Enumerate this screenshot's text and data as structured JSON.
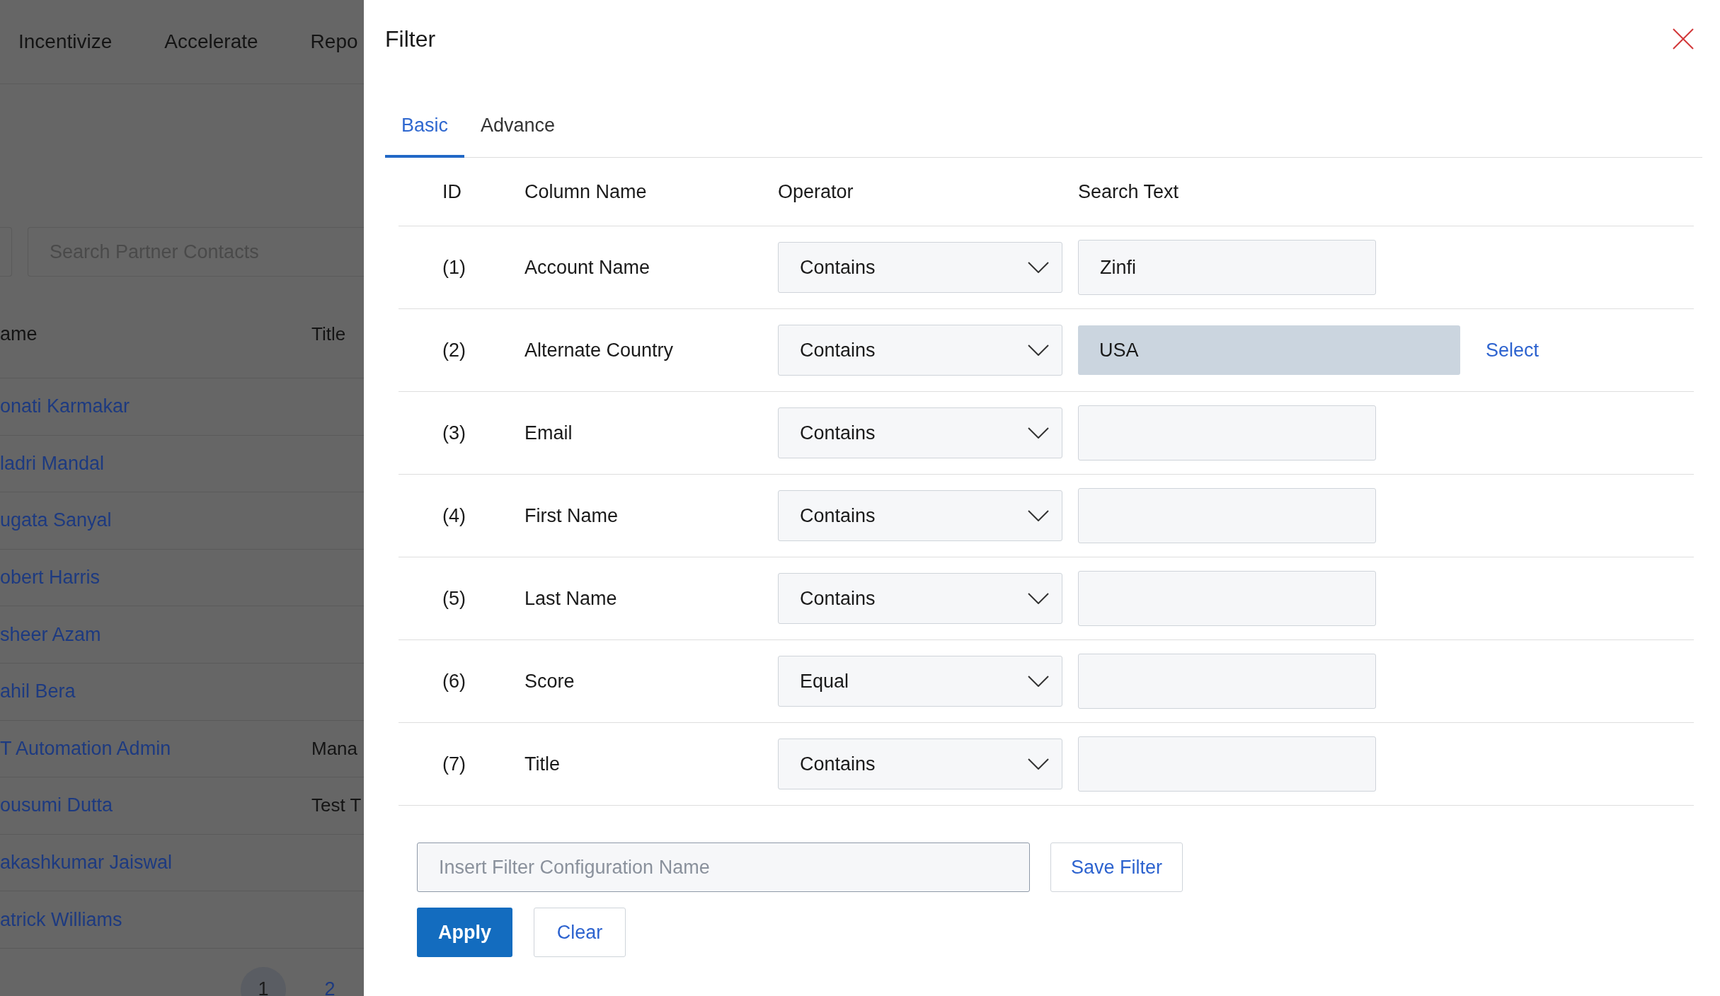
{
  "background_page": {
    "nav": [
      "Incentivize",
      "Accelerate",
      "Repo"
    ],
    "search": {
      "placeholder": "Search Partner Contacts"
    },
    "table": {
      "columns": [
        "ame",
        "Title"
      ],
      "rows": [
        {
          "name": "onati Karmakar"
        },
        {
          "name": "ladri Mandal"
        },
        {
          "name": "ugata Sanyal"
        },
        {
          "name": "obert Harris"
        },
        {
          "name": "sheer Azam"
        },
        {
          "name": "ahil Bera"
        },
        {
          "name": "T Automation Admin",
          "title": "Mana"
        },
        {
          "name": "ousumi Dutta",
          "title": "Test T"
        },
        {
          "name": "akashkumar Jaiswal"
        },
        {
          "name": "atrick Williams"
        }
      ]
    },
    "pagination": [
      {
        "label": "1",
        "selected": true
      },
      {
        "label": "2",
        "selected": false
      }
    ]
  },
  "filter_panel": {
    "title": "Filter",
    "tabs": [
      {
        "label": "Basic",
        "selected": true
      },
      {
        "label": "Advance",
        "selected": false
      }
    ],
    "columns": [
      "ID",
      "Column Name",
      "Operator",
      "Search Text"
    ],
    "rows": [
      {
        "id": "(1)",
        "column": "Account Name",
        "operator": "Contains",
        "kind": "text",
        "value": "Zinfi"
      },
      {
        "id": "(2)",
        "column": "Alternate Country",
        "operator": "Contains",
        "kind": "lookup",
        "value": "USA",
        "action": "Select"
      },
      {
        "id": "(3)",
        "column": "Email",
        "operator": "Contains",
        "kind": "text"
      },
      {
        "id": "(4)",
        "column": "First Name",
        "operator": "Contains",
        "kind": "text"
      },
      {
        "id": "(5)",
        "column": "Last Name",
        "operator": "Contains",
        "kind": "text"
      },
      {
        "id": "(6)",
        "column": "Score",
        "operator": "Equal",
        "kind": "text"
      },
      {
        "id": "(7)",
        "column": "Title",
        "operator": "Contains",
        "kind": "text"
      }
    ],
    "config": {
      "placeholder": "Insert Filter Configuration Name"
    },
    "save_button": "Save Filter",
    "buttons": [
      {
        "label": "Apply",
        "kind": "primary"
      },
      {
        "label": "Clear",
        "kind": "secondary"
      }
    ]
  }
}
